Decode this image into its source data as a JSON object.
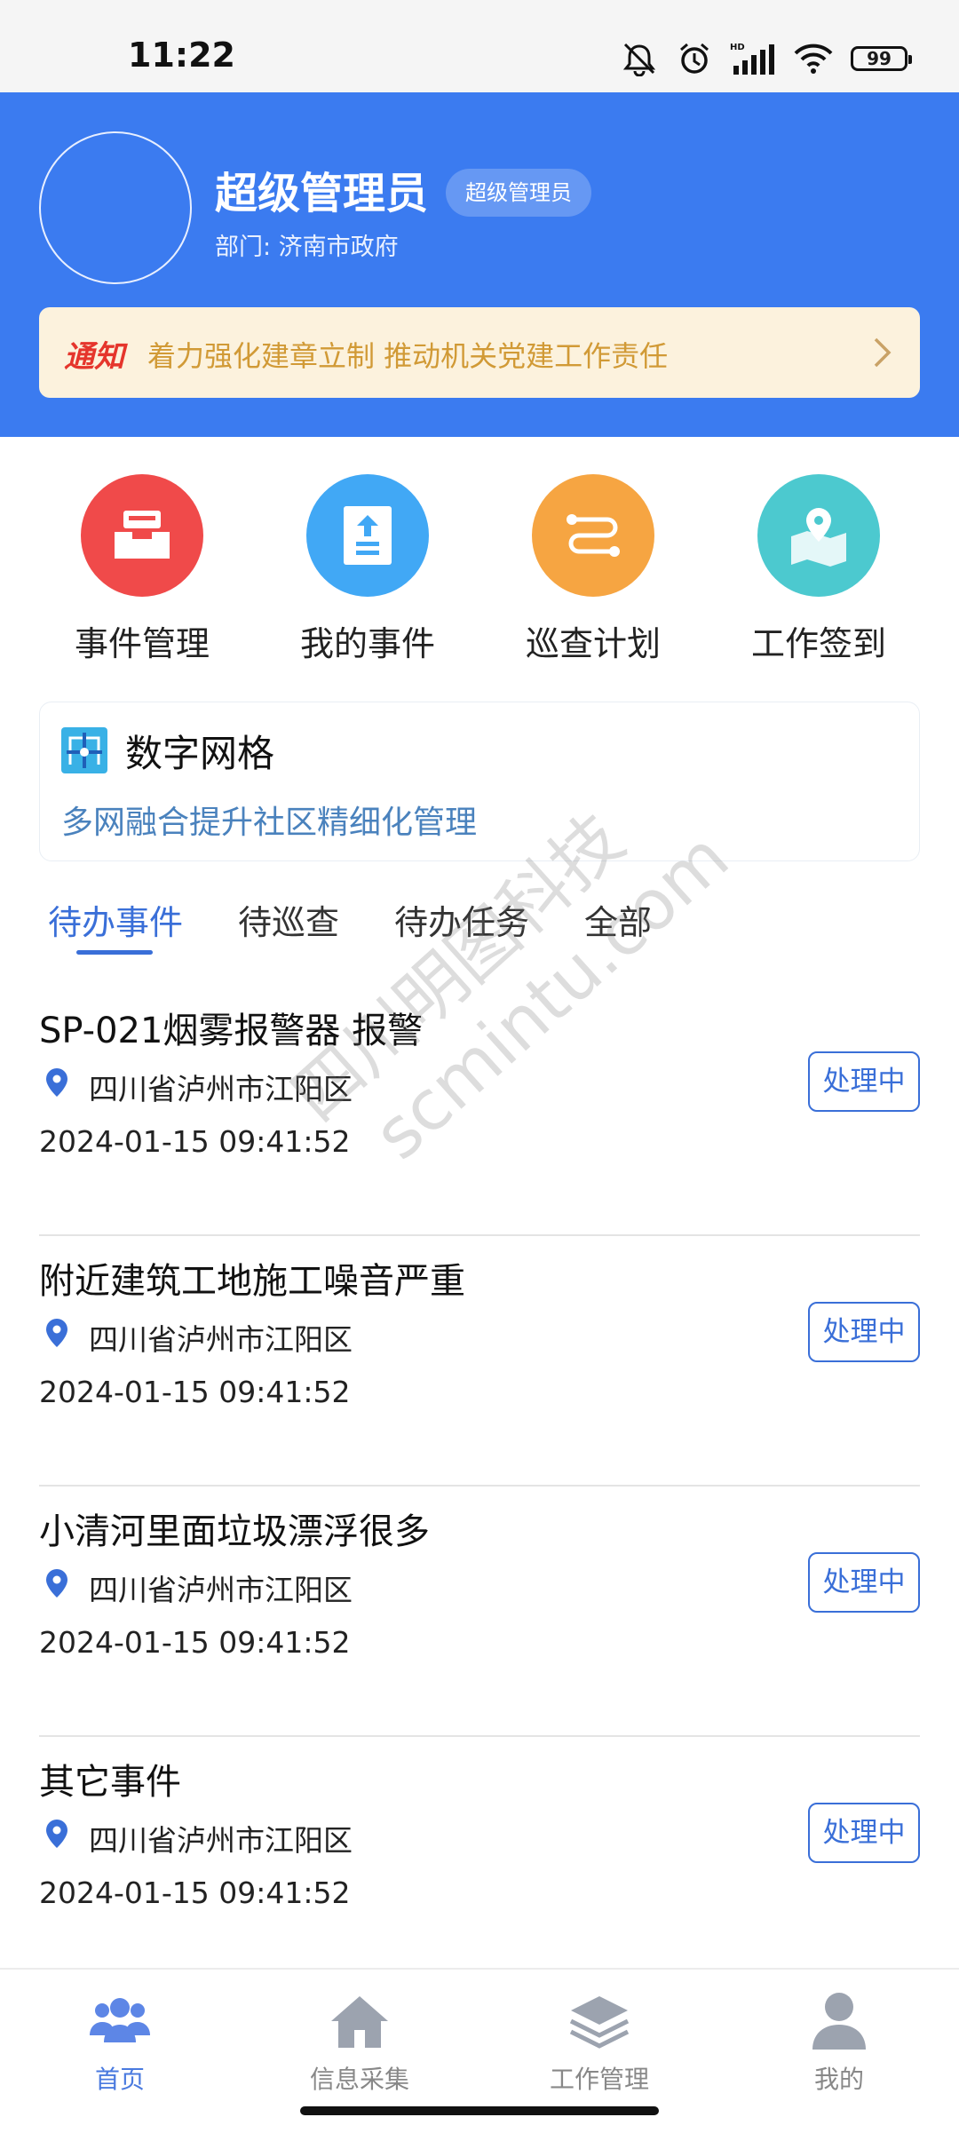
{
  "status_bar": {
    "time": "11:22",
    "battery": "99"
  },
  "header": {
    "user_name": "超级管理员",
    "role_badge": "超级管理员",
    "department": "部门: 济南市政府",
    "notice": {
      "tag": "通知",
      "text": "着力强化建章立制 推动机关党建工作责任"
    }
  },
  "quick_menu": [
    {
      "label": "事件管理",
      "icon": "inbox-icon",
      "color": "#f04a4a"
    },
    {
      "label": "我的事件",
      "icon": "upload-document-icon",
      "color": "#41a8f5"
    },
    {
      "label": "巡查计划",
      "icon": "route-icon",
      "color": "#f6a542"
    },
    {
      "label": "工作签到",
      "icon": "map-pin-icon",
      "color": "#4cc9cf"
    }
  ],
  "grid_card": {
    "title": "数字网格",
    "subtitle": "多网融合提升社区精细化管理"
  },
  "tabs": [
    {
      "label": "待办事件",
      "active": true
    },
    {
      "label": "待巡查",
      "active": false
    },
    {
      "label": "待办任务",
      "active": false
    },
    {
      "label": "全部",
      "active": false
    }
  ],
  "events": [
    {
      "title": "SP-021烟雾报警器 报警",
      "location": "四川省泸州市江阳区",
      "time": "2024-01-15 09:41:52",
      "status": "处理中"
    },
    {
      "title": "附近建筑工地施工噪音严重",
      "location": "四川省泸州市江阳区",
      "time": "2024-01-15 09:41:52",
      "status": "处理中"
    },
    {
      "title": "小清河里面垃圾漂浮很多",
      "location": "四川省泸州市江阳区",
      "time": "2024-01-15 09:41:52",
      "status": "处理中"
    },
    {
      "title": "其它事件",
      "location": "四川省泸州市江阳区",
      "time": "2024-01-15 09:41:52",
      "status": "处理中"
    }
  ],
  "watermark": {
    "line1": "四川明图科技",
    "line2": "scmintu.com"
  },
  "bottom_nav": [
    {
      "label": "首页",
      "icon": "users-icon",
      "active": true
    },
    {
      "label": "信息采集",
      "icon": "home-icon",
      "active": false
    },
    {
      "label": "工作管理",
      "icon": "layers-icon",
      "active": false
    },
    {
      "label": "我的",
      "icon": "person-icon",
      "active": false
    }
  ],
  "colors": {
    "primary": "#3b7bf0",
    "accent_text": "#3a6fd8",
    "notice_bg": "#fcf2dd",
    "notice_text": "#d19a36",
    "notice_tag": "#e5352c"
  }
}
